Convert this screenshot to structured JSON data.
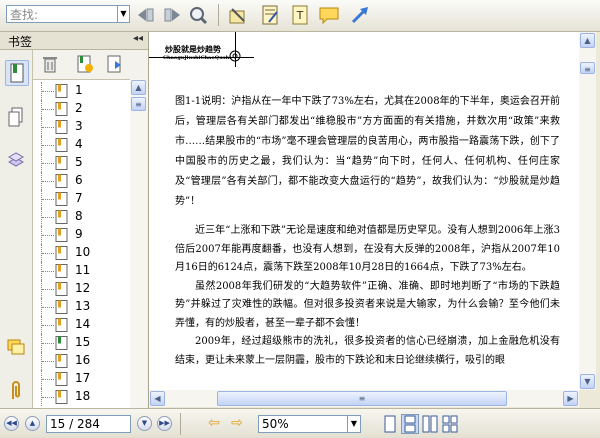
{
  "toolbar": {
    "search_placeholder": "查找:",
    "search_value": "",
    "icons": [
      "prev-search-icon",
      "next-search-icon",
      "zoom-search-icon",
      "highlight-tool-icon",
      "edit-note-icon",
      "text-box-icon",
      "comment-icon",
      "arrow-tool-icon"
    ]
  },
  "sidebar": {
    "title": "书签",
    "collapse": "◂◂",
    "bookmarks": [
      "1",
      "2",
      "3",
      "4",
      "5",
      "6",
      "7",
      "8",
      "9",
      "10",
      "11",
      "12",
      "13",
      "14",
      "15",
      "16",
      "17",
      "18"
    ],
    "active_bookmark_index": 14
  },
  "document": {
    "header_title": "炒股就是炒趋势",
    "header_subtitle": "ChaoguJiushiChaoQushi",
    "caption": "图1-1说明：沪指从在一年中下跌了73%左右，尤其在2008年的下半年，奥运会召开前后，管理层各有关部门都发出“维稳股市”方方面面的有关措施，并数次用“政策”来救市……结果股市的“市场”毫不理会管理层的良苦用心，两市股指一路震荡下跌，创下了中国股市的历史之最，我们认为：当“趋势”向下时，任何人、任何机构、任何庄家及“管理层”各有关部门，都不能改变大盘运行的“趋势”，故我们认为：“炒股就是炒趋势”！",
    "paragraphs": [
      "近三年“上涨和下跌”无论是速度和绝对值都是历史罕见。没有人想到2006年上涨3倍后2007年能再度翻番，也没有人想到，在没有大反弹的2008年，沪指从2007年10月16日的6124点，震荡下跌至2008年10月28日的1664点，下跌了73%左右。",
      "虽然2008年我们研发的“大趋势软件”正确、准确、即时地判断了“市场的下跌趋势”并躲过了灾难性的跌幅。但对很多投资者来说是大输家，为什么会输？至今他们未弄懂，有的炒股者，甚至一辈子都不会懂！",
      "2009年，经过超级熊市的洗礼，很多投资者的信心已经崩溃，加上金融危机没有结束，更让未来蒙上一层阴霾，股市的下跌论和末日论继续横行，吸引的眼"
    ]
  },
  "statusbar": {
    "page_display": "15 / 284",
    "zoom": "50%"
  },
  "colors": {
    "chrome": "#ece9d8",
    "scrollbar_accent": "#c3d3f5",
    "nav_arrow": "#e0a020"
  }
}
